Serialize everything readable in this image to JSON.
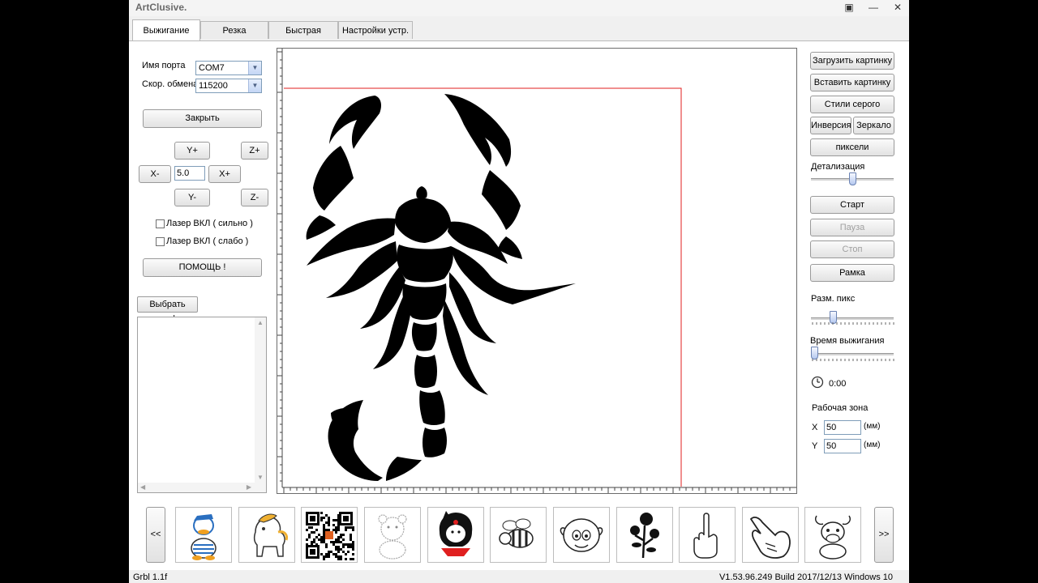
{
  "app": {
    "title": "ArtClusive.",
    "controls": {
      "restore": "▣",
      "minimize": "—",
      "close": "✕"
    }
  },
  "tabs": [
    {
      "label": "Выжигание",
      "active": true
    },
    {
      "label": "Резка",
      "active": false
    },
    {
      "label": "Быстрая разметка",
      "active": false
    },
    {
      "label": "Настройки устр.",
      "active": false
    }
  ],
  "left": {
    "port_label": "Имя порта",
    "port_value": "COM7",
    "baud_label": "Скор. обмена",
    "baud_value": "115200",
    "close_button": "Закрыть",
    "jog": {
      "y_plus": "Y+",
      "y_minus": "Y-",
      "x_minus": "X-",
      "x_plus": "X+",
      "z_plus": "Z+",
      "z_minus": "Z-",
      "step": "5.0"
    },
    "laser_strong": "Лазер ВКЛ ( сильно )",
    "laser_weak": "Лазер ВКЛ ( слабо )",
    "help_button": "ПОМОЩЬ !",
    "font_button": "Выбрать шрифт"
  },
  "right": {
    "load_image": "Загрузить картинку",
    "paste_image": "Вставить картинку",
    "gray_styles": "Стили серого",
    "inversion": "Инверсия",
    "mirror": "Зеркало",
    "pixels": "пиксели",
    "detail_label": "Детализация",
    "detail_level": 0.5,
    "start": "Старт",
    "pause": "Пауза",
    "stop": "Стоп",
    "frame": "Рамка",
    "pixel_size_label": "Разм. пикс",
    "pixel_size_level": 0.25,
    "burn_time_label": "Время выжигания",
    "burn_time_level": 0.0,
    "timer": "0:00",
    "work_area_label": "Рабочая зона",
    "x_label": "X",
    "x_value": "50",
    "y_label": "Y",
    "y_value": "50",
    "unit": "(мм)"
  },
  "gallery": {
    "prev": "<<",
    "next": ">>",
    "items": [
      "duck-icon",
      "horse-icon",
      "qr-code-icon",
      "bear-icon",
      "girl-icon",
      "bee-icon",
      "sheep-icon",
      "rose-icon",
      "hand-gesture-icon",
      "pointing-hand-icon",
      "cow-icon"
    ]
  },
  "status": {
    "left": "Grbl 1.1f",
    "right": "V1.53.96.249 Build 2017/12/13 Windows 10"
  }
}
